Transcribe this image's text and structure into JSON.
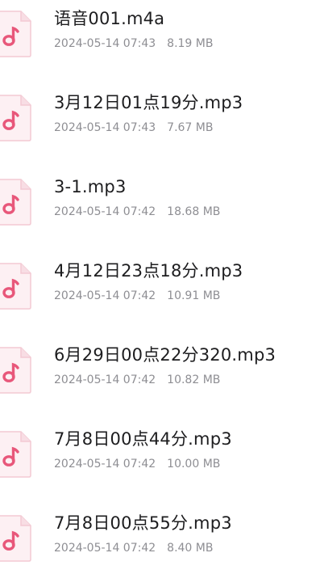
{
  "files": [
    {
      "name": "语音001.m4a",
      "date": "2024-05-14 07:43",
      "size": "8.19 MB",
      "icon": "music-file-icon"
    },
    {
      "name": "3月12日01点19分.mp3",
      "date": "2024-05-14 07:43",
      "size": "7.67 MB",
      "icon": "music-file-icon"
    },
    {
      "name": "3-1.mp3",
      "date": "2024-05-14 07:42",
      "size": "18.68 MB",
      "icon": "music-file-icon"
    },
    {
      "name": "4月12日23点18分.mp3",
      "date": "2024-05-14 07:42",
      "size": "10.91 MB",
      "icon": "music-file-icon"
    },
    {
      "name": "6月29日00点22分320.mp3",
      "date": "2024-05-14 07:42",
      "size": "10.82 MB",
      "icon": "music-file-icon"
    },
    {
      "name": "7月8日00点44分.mp3",
      "date": "2024-05-14 07:42",
      "size": "10.00 MB",
      "icon": "music-file-icon"
    },
    {
      "name": "7月8日00点55分.mp3",
      "date": "2024-05-14 07:42",
      "size": "8.40 MB",
      "icon": "music-file-icon"
    }
  ],
  "colors": {
    "icon_fill": "#fdf0f3",
    "icon_border": "#f3c9d3",
    "icon_glyph": "#e8577a",
    "name_text": "#1d1d1f",
    "meta_text": "#8e8e93"
  }
}
